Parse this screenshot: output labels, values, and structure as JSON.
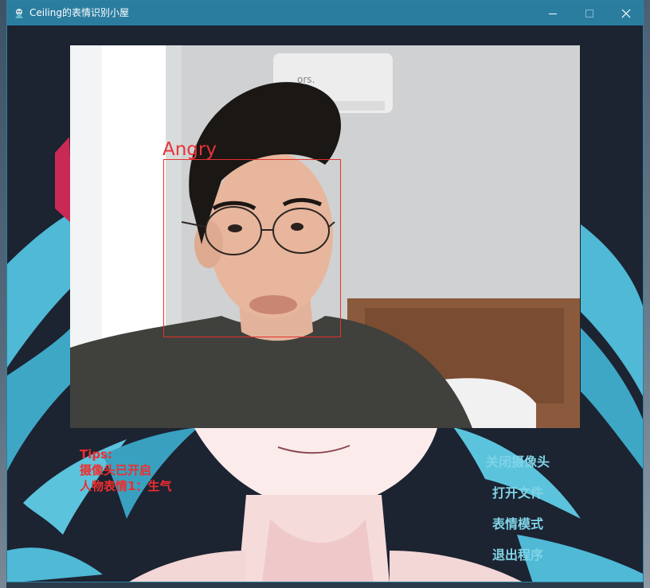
{
  "window": {
    "title": "Ceiling的表情识别小屋"
  },
  "detection": {
    "emotion_label": "Angry"
  },
  "tips": {
    "heading": "Tips:",
    "line1": "摄像头已开启",
    "line2": "人物表情1：生气"
  },
  "buttons": {
    "close_camera": "关闭摄像头",
    "open_file": "打开文件",
    "emotion_mode": "表情模式",
    "exit": "退出程序"
  },
  "colors": {
    "titlebar": "#2b7da0",
    "background": "#1c2331",
    "tips_text": "#ee2e2e",
    "button_text": "#7fd4e6",
    "face_box": "#e4322f"
  }
}
